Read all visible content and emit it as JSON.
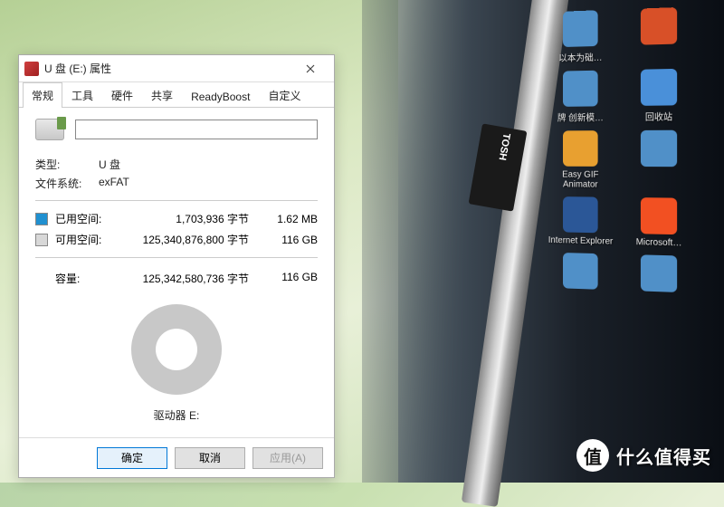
{
  "dialog": {
    "title": "U 盘 (E:) 属性",
    "tabs": [
      "常规",
      "工具",
      "硬件",
      "共享",
      "ReadyBoost",
      "自定义"
    ],
    "active_tab": 0,
    "name_value": "",
    "type_label": "类型:",
    "type_value": "U 盘",
    "fs_label": "文件系统:",
    "fs_value": "exFAT",
    "used": {
      "label": "已用空间:",
      "bytes": "1,703,936 字节",
      "human": "1.62 MB",
      "color": "#2090d0"
    },
    "free": {
      "label": "可用空间:",
      "bytes": "125,340,876,800 字节",
      "human": "116 GB",
      "color": "#d8d8d8"
    },
    "total": {
      "label": "容量:",
      "bytes": "125,342,580,736 字节",
      "human": "116 GB"
    },
    "drive_label": "驱动器 E:",
    "buttons": {
      "ok": "确定",
      "cancel": "取消",
      "apply": "应用(A)"
    }
  },
  "desktop": {
    "icons": [
      {
        "label": "以本为础…",
        "bg": "ico-other"
      },
      {
        "label": "",
        "bg": "ico-orange"
      },
      {
        "label": "牌 创新模…",
        "bg": "ico-other"
      },
      {
        "label": "回收站",
        "bg": "ico-recycle"
      },
      {
        "label": "Easy GIF Animator",
        "bg": "ico-gif"
      },
      {
        "label": "",
        "bg": "ico-other"
      },
      {
        "label": "Internet Explorer",
        "bg": "ico-ie"
      },
      {
        "label": "Microsoft…",
        "bg": "ico-ms"
      },
      {
        "label": "",
        "bg": "ico-other"
      },
      {
        "label": "",
        "bg": "ico-other"
      }
    ]
  },
  "sd_card": {
    "brand": "TOSH"
  },
  "watermark": {
    "circle": "值",
    "text": "什么值得买"
  }
}
